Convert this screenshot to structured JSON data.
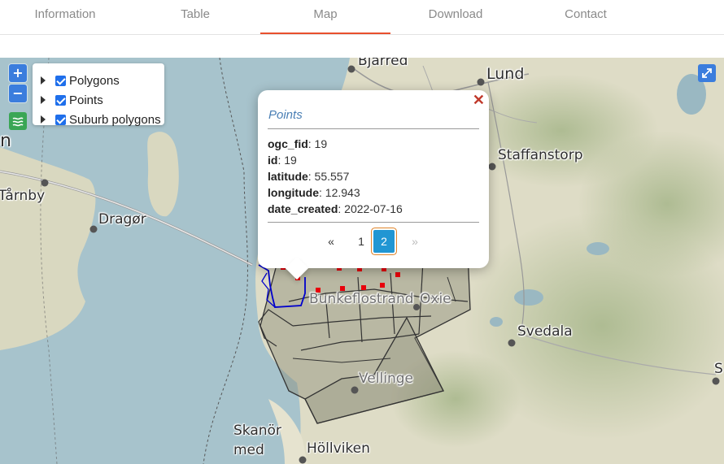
{
  "nav": {
    "tabs": [
      {
        "label": "Information"
      },
      {
        "label": "Table"
      },
      {
        "label": "Map"
      },
      {
        "label": "Download"
      },
      {
        "label": "Contact"
      }
    ],
    "active_tab": "Map"
  },
  "map": {
    "places": {
      "bjarred": "Bjärred",
      "lund": "Lund",
      "staffanstorp": "Staffanstorp",
      "tarnby": "Tårnby",
      "dragor": "Dragør",
      "bunkeflostrand": "Bunkeflostrand",
      "oxie": "Oxie",
      "svedala": "Svedala",
      "vellinge": "Vellinge",
      "skanor1": "Skanör",
      "skanor2": "med",
      "hollviken": "Höllviken",
      "edge_left": "n",
      "edge_right": "S"
    },
    "controls": {
      "zoom_in": "+",
      "zoom_out": "−"
    },
    "layers": [
      {
        "label": "Polygons",
        "checked": true
      },
      {
        "label": "Points",
        "checked": true
      },
      {
        "label": "Suburb polygons",
        "checked": true
      }
    ],
    "colors": {
      "points": "#e8000b",
      "suburb_outline": "#0000cc",
      "polygon_fill": "#8c8c78",
      "water": "#aac6cf",
      "land": "#d9d8c0"
    }
  },
  "popup": {
    "title": "Points",
    "close": "✕",
    "fields": [
      {
        "key": "ogc_fid",
        "value": ": 19"
      },
      {
        "key": "id",
        "value": ": 19"
      },
      {
        "key": "latitude",
        "value": ": 55.557"
      },
      {
        "key": "longitude",
        "value": ": 12.943"
      },
      {
        "key": "date_created",
        "value": ": 2022-07-16"
      }
    ],
    "pager": {
      "prev": "«",
      "page1": "1",
      "page2": "2",
      "next": "»",
      "current": 2
    }
  }
}
